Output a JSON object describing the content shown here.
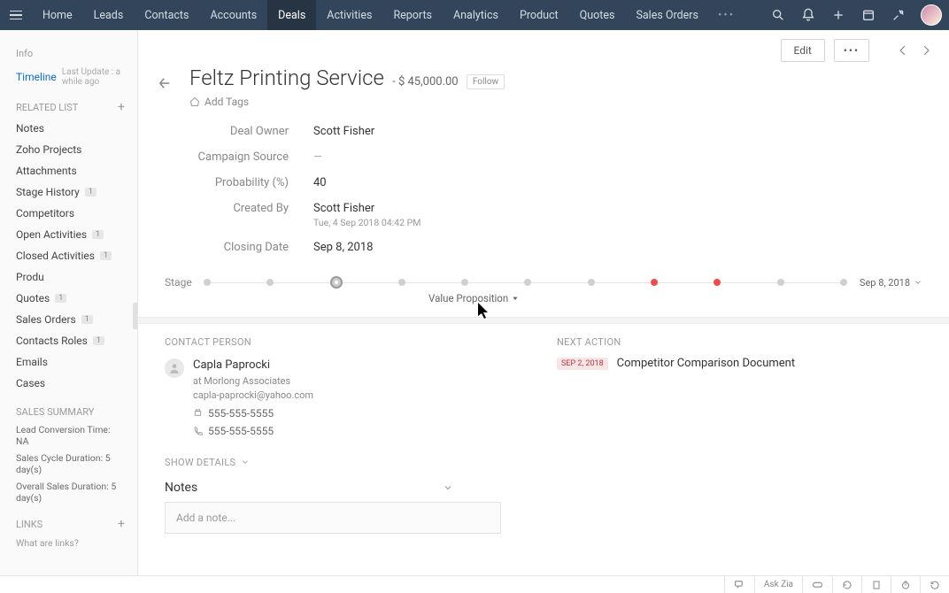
{
  "nav": {
    "items": [
      "Home",
      "Leads",
      "Contacts",
      "Accounts",
      "Deals",
      "Activities",
      "Reports",
      "Analytics",
      "Product",
      "Quotes",
      "Sales Orders"
    ],
    "active_index": 4,
    "more": "•••"
  },
  "toolbar": {
    "edit": "Edit",
    "more": "•••"
  },
  "sidebar": {
    "info_head": "Info",
    "timeline": "Timeline",
    "timeline_sub": "Last Update : a while ago",
    "related_head": "RELATED LIST",
    "items": [
      {
        "label": "Notes",
        "badge": null
      },
      {
        "label": "Zoho Projects",
        "badge": null
      },
      {
        "label": "Attachments",
        "badge": null
      },
      {
        "label": "Stage History",
        "badge": "1"
      },
      {
        "label": "Competitors",
        "badge": null
      },
      {
        "label": "Open Activities",
        "badge": "1"
      },
      {
        "label": "Closed Activities",
        "badge": "1"
      },
      {
        "label": "Produ",
        "badge": null
      },
      {
        "label": "Quotes",
        "badge": "1"
      },
      {
        "label": "Sales Orders",
        "badge": "1"
      },
      {
        "label": "Contacts Roles",
        "badge": "1"
      },
      {
        "label": "Emails",
        "badge": null
      },
      {
        "label": "Cases",
        "badge": null
      }
    ],
    "sales_summary_head": "SALES SUMMARY",
    "summary": [
      "Lead Conversion Time: NA",
      "Sales Cycle Duration: 5 day(s)",
      "Overall Sales Duration: 5 day(s)"
    ],
    "links_head": "LINKS",
    "links_sub": "What are links?"
  },
  "record": {
    "title": "Feltz Printing Service",
    "amount_prefix": "- $",
    "amount": "45,000.00",
    "follow": "Follow",
    "add_tags": "Add Tags",
    "fields": {
      "deal_owner_label": "Deal Owner",
      "deal_owner_value": "Scott Fisher",
      "campaign_source_label": "Campaign Source",
      "campaign_source_value": "—",
      "probability_label": "Probability (%)",
      "probability_value": "40",
      "created_by_label": "Created By",
      "created_by_value": "Scott Fisher",
      "created_by_sub": "Tue, 4 Sep 2018 04:42 PM",
      "closing_date_label": "Closing Date",
      "closing_date_value": "Sep 8, 2018"
    }
  },
  "stage": {
    "label": "Stage",
    "current_name": "Value Proposition",
    "closing_display": "Sep 8, 2018",
    "dots_count": 11,
    "current_index": 2,
    "red_indices": [
      7,
      8
    ]
  },
  "contact": {
    "head": "CONTACT PERSON",
    "name": "Capla Paprocki",
    "company": "at Morlong Associates",
    "email": "capla-paprocki@yahoo.com",
    "phone1": "555-555-5555",
    "phone2": "555-555-5555"
  },
  "next_action": {
    "head": "NEXT ACTION",
    "date": "SEP 2, 2018",
    "title": "Competitor Comparison Document"
  },
  "show_details": "SHOW DETAILS",
  "notes": {
    "title": "Notes",
    "placeholder": "Add a note..."
  },
  "bottombar": {
    "ask": "Ask Zia"
  }
}
